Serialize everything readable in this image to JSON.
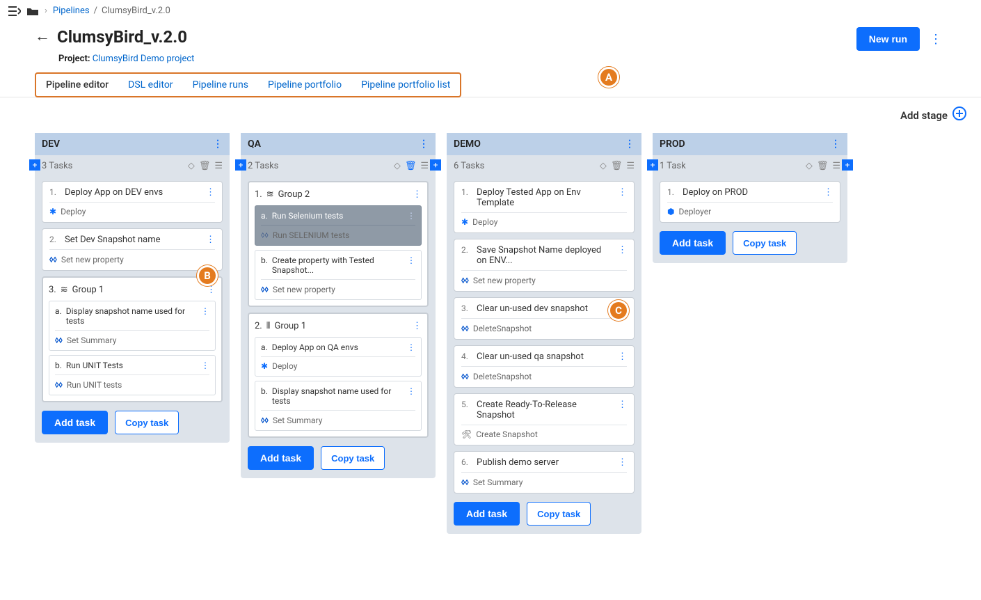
{
  "breadcrumb": {
    "link": "Pipelines",
    "current": "ClumsyBird_v.2.0"
  },
  "header": {
    "title": "ClumsyBird_v.2.0",
    "project_label": "Project: ",
    "project_link": "ClumsyBird Demo project",
    "new_run": "New run"
  },
  "tabs": {
    "t1": "Pipeline editor",
    "t2": "DSL editor",
    "t3": "Pipeline runs",
    "t4": "Pipeline portfolio",
    "t5": "Pipeline portfolio list"
  },
  "addstage": "Add stage",
  "stages": {
    "dev": {
      "name": "DEV",
      "count": "3 Tasks",
      "t1": "Deploy App on DEV envs",
      "m1": "Deploy",
      "t2": "Set Dev Snapshot name",
      "m2": "Set new property",
      "g1": "Group 1",
      "g1a": "Display snapshot name used for tests",
      "g1am": "Set Summary",
      "g1b": "Run UNIT Tests",
      "g1bm": "Run UNIT tests"
    },
    "qa": {
      "name": "QA",
      "count": "2 Tasks",
      "g2": "Group 2",
      "g2a": "Run Selenium tests",
      "g2am": "Run SELENIUM tests",
      "g2b": "Create property with Tested Snapshot...",
      "g2bm": "Set new property",
      "g1": "Group 1",
      "g1a": "Deploy App on QA envs",
      "g1am": "Deploy",
      "g1b": "Display snapshot name used for tests",
      "g1bm": "Set Summary"
    },
    "demo": {
      "name": "DEMO",
      "count": "6 Tasks",
      "t1": "Deploy Tested App on Env Template",
      "m1": "Deploy",
      "t2": "Save Snapshot Name deployed on ENV...",
      "m2": "Set new property",
      "t3": "Clear un-used dev snapshot",
      "m3": "DeleteSnapshot",
      "t4": "Clear un-used qa snapshot",
      "m4": "DeleteSnapshot",
      "t5": "Create Ready-To-Release Snapshot",
      "m5": "Create Snapshot",
      "t6": "Publish demo server",
      "m6": "Set Summary"
    },
    "prod": {
      "name": "PROD",
      "count": "1 Task",
      "t1": "Deploy on PROD",
      "m1": "Deployer"
    }
  },
  "buttons": {
    "add": "Add task",
    "copy": "Copy task"
  },
  "nums": {
    "n1": "1.",
    "n2": "2.",
    "n3": "3.",
    "n4": "4.",
    "n5": "5.",
    "n6": "6.",
    "a": "a.",
    "b": "b."
  },
  "callouts": {
    "a": "A",
    "b": "B",
    "c": "C"
  }
}
